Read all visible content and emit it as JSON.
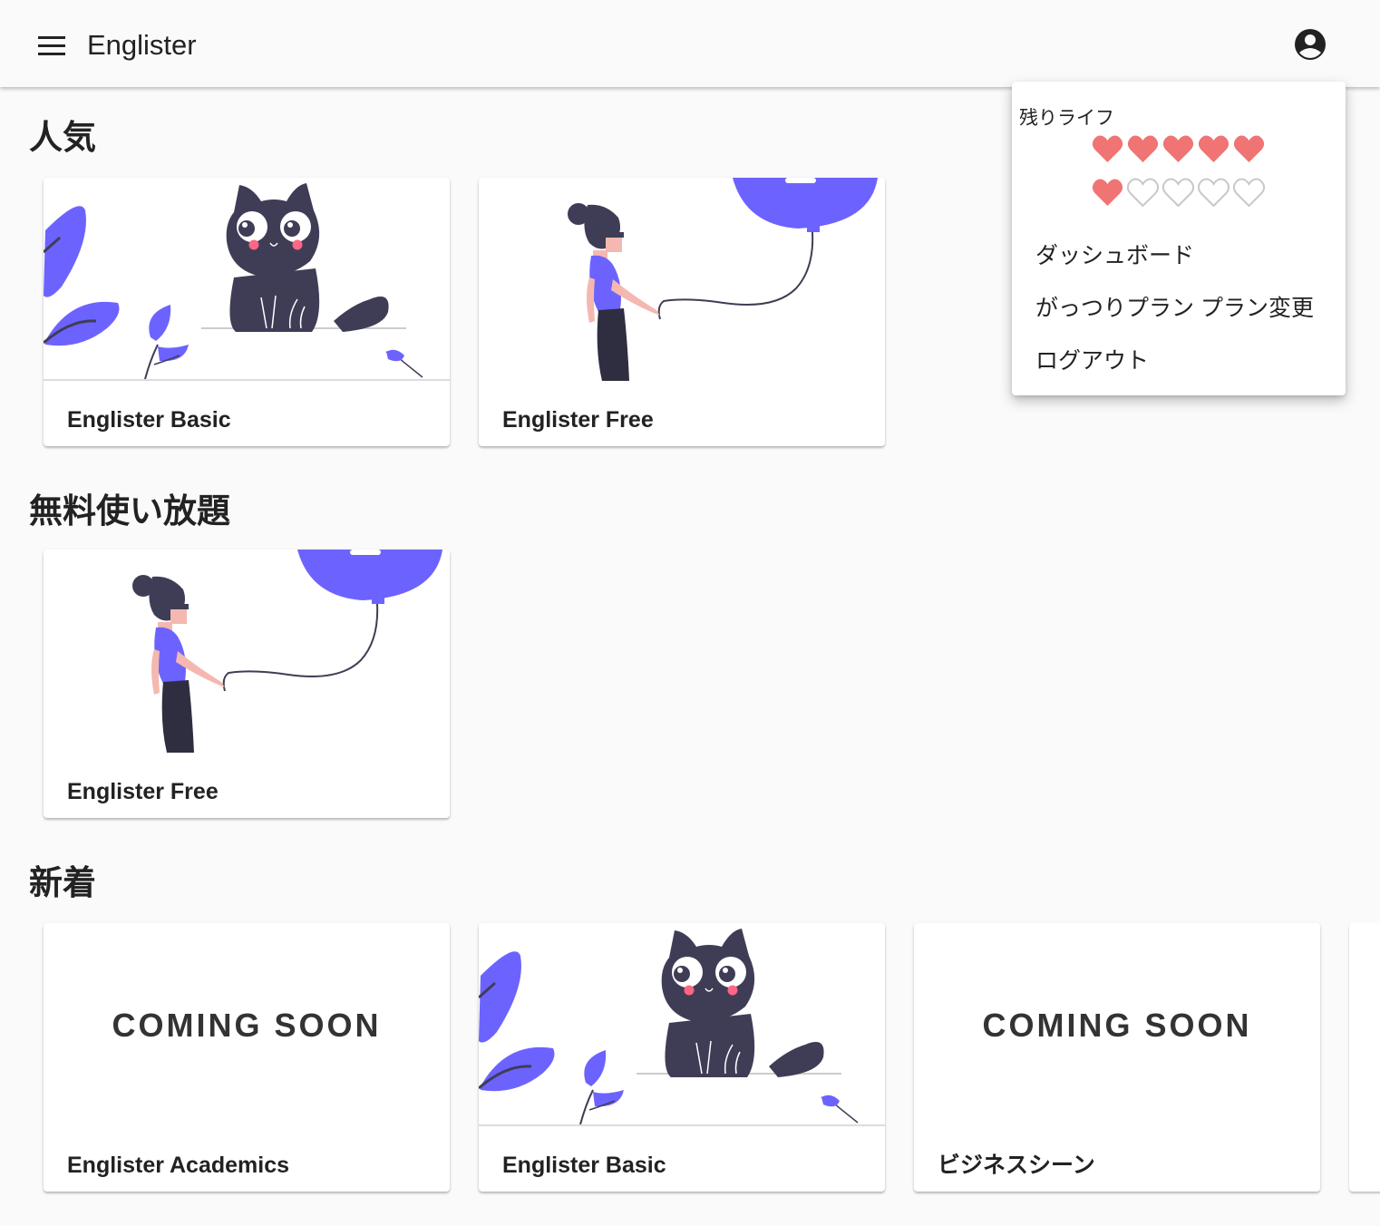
{
  "appbar": {
    "title": "Englister",
    "menu_icon": "hamburger-menu-icon",
    "account_icon": "account-circle-icon"
  },
  "sections": [
    {
      "title": "人気",
      "cards": [
        {
          "title": "Englister Basic",
          "image": "cat-illustration"
        },
        {
          "title": "Englister Free",
          "image": "balloon-girl-illustration"
        }
      ]
    },
    {
      "title": "無料使い放題",
      "cards": [
        {
          "title": "Englister Free",
          "image": "balloon-girl-illustration"
        }
      ]
    },
    {
      "title": "新着",
      "cards": [
        {
          "title": "Englister Academics",
          "image": "coming-soon",
          "image_text": "COMING SOON"
        },
        {
          "title": "Englister Basic",
          "image": "cat-illustration"
        },
        {
          "title": "ビジネスシーン",
          "image": "coming-soon",
          "image_text": "COMING SOON"
        }
      ]
    }
  ],
  "account_menu": {
    "life_label": "残りライフ",
    "lives_total": 10,
    "lives_remaining": 6,
    "items": [
      {
        "label": "ダッシュボード"
      },
      {
        "label": "がっつりプラン プラン変更"
      },
      {
        "label": "ログアウト"
      }
    ]
  },
  "colors": {
    "accent": "#6c63ff",
    "dark": "#3f3d56",
    "heart": "#f07474",
    "heart_empty": "#c8c8c8",
    "blush": "#ff6584",
    "skin": "#f4b8b0"
  }
}
